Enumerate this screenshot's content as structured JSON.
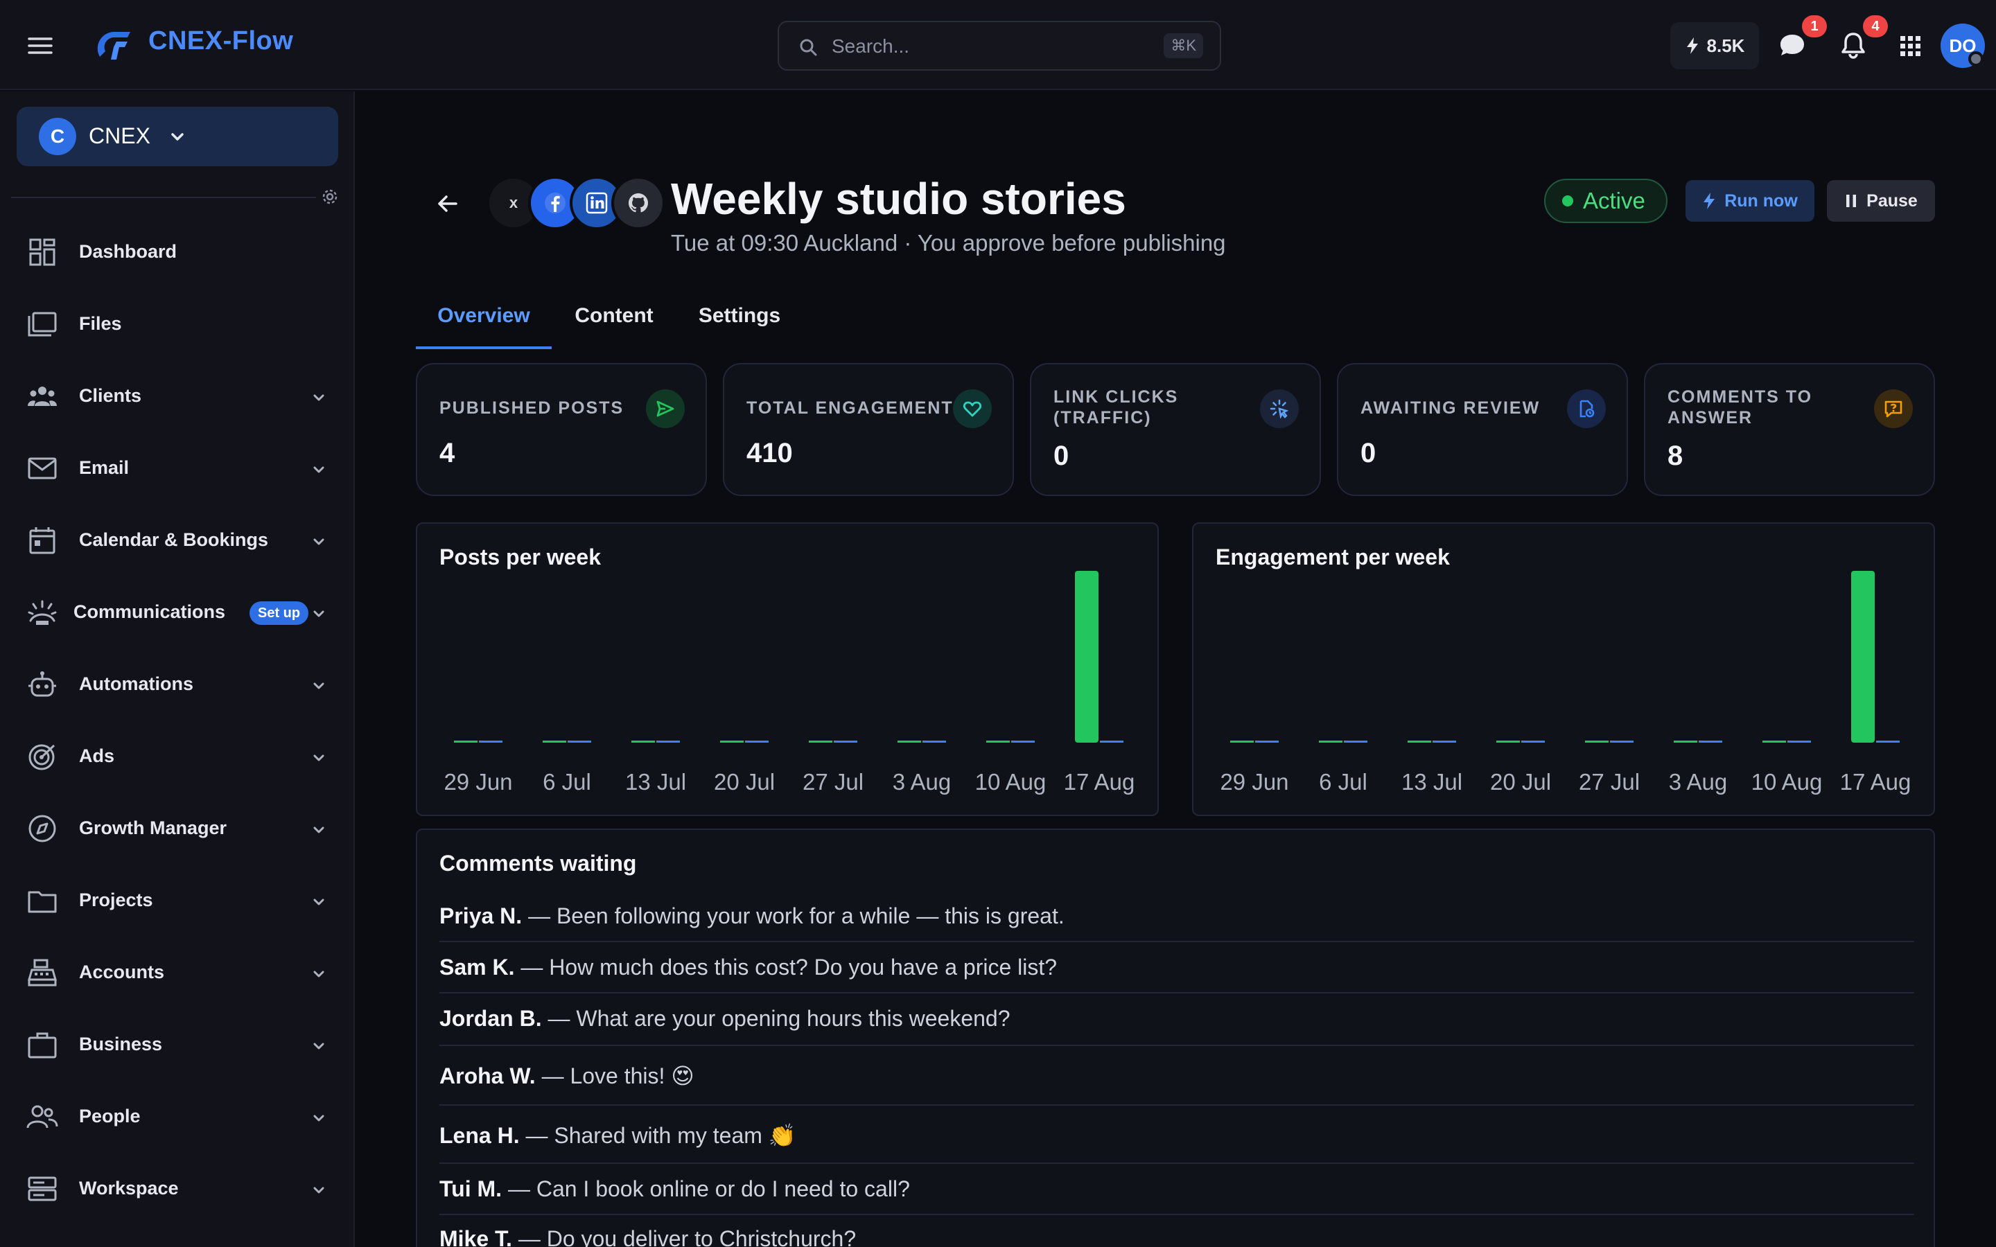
{
  "app": {
    "name": "CNEX-Flow"
  },
  "search": {
    "placeholder": "Search...",
    "shortcut": "⌘K"
  },
  "topbar": {
    "credits": "8.5K",
    "messages_badge": "1",
    "notifications_badge": "4",
    "avatar_initials": "DO"
  },
  "org": {
    "initial": "C",
    "name": "CNEX"
  },
  "sidebar": {
    "items": [
      {
        "label": "Dashboard",
        "icon": "dashboard-icon"
      },
      {
        "label": "Files",
        "icon": "files-icon"
      },
      {
        "label": "Clients",
        "icon": "clients-icon"
      },
      {
        "label": "Email",
        "icon": "email-icon"
      },
      {
        "label": "Calendar & Bookings",
        "icon": "calendar-icon"
      },
      {
        "label": "Communications",
        "icon": "communications-icon",
        "badge": "Set up"
      },
      {
        "label": "Automations",
        "icon": "robot-icon"
      },
      {
        "label": "Ads",
        "icon": "target-icon"
      },
      {
        "label": "Growth Manager",
        "icon": "compass-icon"
      },
      {
        "label": "Projects",
        "icon": "folder-icon"
      },
      {
        "label": "Accounts",
        "icon": "register-icon"
      },
      {
        "label": "Business",
        "icon": "briefcase-icon"
      },
      {
        "label": "People",
        "icon": "people-icon"
      },
      {
        "label": "Workspace",
        "icon": "server-icon"
      }
    ]
  },
  "header": {
    "networks": [
      "X",
      "Facebook",
      "LinkedIn",
      "GitHub"
    ],
    "x_label": "x",
    "title": "Weekly studio stories",
    "subtitle": "Tue at 09:30 Auckland · You approve before publishing",
    "status": "Active",
    "run_label": "Run now",
    "pause_label": "Pause"
  },
  "tabs": [
    {
      "label": "Overview",
      "active": true
    },
    {
      "label": "Content",
      "active": false
    },
    {
      "label": "Settings",
      "active": false
    }
  ],
  "stats": [
    {
      "label": "Published posts",
      "value": "4",
      "icon": "send-icon",
      "color": "#22c55e"
    },
    {
      "label": "Total engagement",
      "value": "410",
      "icon": "heart-icon",
      "color": "#2dd4bf"
    },
    {
      "label": "Link clicks (traffic)",
      "value": "0",
      "icon": "click-icon",
      "color": "#60a5fa"
    },
    {
      "label": "Awaiting review",
      "value": "0",
      "icon": "review-doc-icon",
      "color": "#3b82f6"
    },
    {
      "label": "Comments to answer",
      "value": "8",
      "icon": "comment-question-icon",
      "color": "#f59e0b"
    }
  ],
  "chart_data": [
    {
      "type": "bar",
      "title": "Posts per week",
      "categories": [
        "29 Jun",
        "6 Jul",
        "13 Jul",
        "20 Jul",
        "27 Jul",
        "3 Aug",
        "10 Aug",
        "17 Aug"
      ],
      "series": [
        {
          "values": [
            0,
            0,
            0,
            0,
            0,
            0,
            0,
            4
          ],
          "color": "#22c55e"
        },
        {
          "values": [
            0,
            0,
            0,
            0,
            0,
            0,
            0,
            0
          ],
          "color": "#3b82f6"
        }
      ]
    },
    {
      "type": "bar",
      "title": "Engagement per week",
      "categories": [
        "29 Jun",
        "6 Jul",
        "13 Jul",
        "20 Jul",
        "27 Jul",
        "3 Aug",
        "10 Aug",
        "17 Aug"
      ],
      "series": [
        {
          "values": [
            0,
            0,
            0,
            0,
            0,
            0,
            0,
            410
          ],
          "color": "#22c55e"
        },
        {
          "values": [
            0,
            0,
            0,
            0,
            0,
            0,
            0,
            0
          ],
          "color": "#3b82f6"
        }
      ]
    }
  ],
  "comments": {
    "title": "Comments waiting",
    "items": [
      {
        "name": "Priya N.",
        "text": "Been following your work for a while — this is great."
      },
      {
        "name": "Sam K.",
        "text": "How much does this cost? Do you have a price list?"
      },
      {
        "name": "Jordan B.",
        "text": "What are your opening hours this weekend?"
      },
      {
        "name": "Aroha W.",
        "text": "Love this! 😍"
      },
      {
        "name": "Lena H.",
        "text": "Shared with my team 👏"
      },
      {
        "name": "Tui M.",
        "text": "Can I book online or do I need to call?"
      },
      {
        "name": "Mike T.",
        "text": "Do you deliver to Christchurch?"
      }
    ]
  }
}
